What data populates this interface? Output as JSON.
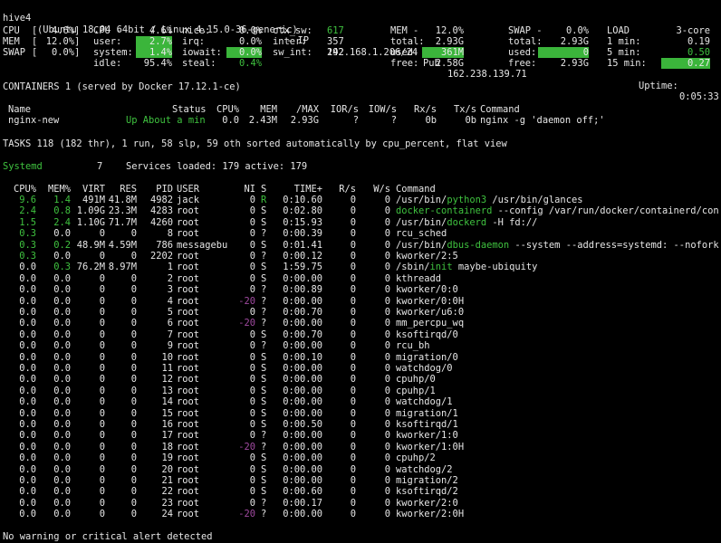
{
  "header": {
    "host": "hive4",
    "os": "(Ubuntu 18.04 64bit / Linux 4.15.0-36-generic)",
    "ip_label": "- IP",
    "ip": "192.168.1.206/24",
    "pub_label": "Pub",
    "pub": "162.238.139.71",
    "uptime_label": "Uptime:",
    "uptime": "0:05:33"
  },
  "quicklook": {
    "cpu": {
      "label": "CPU",
      "pct": "4.6%"
    },
    "mem": {
      "label": "MEM",
      "pct": "12.0%"
    },
    "swap": {
      "label": "SWAP",
      "pct": "0.0%"
    }
  },
  "cpu": {
    "title": "CPU -",
    "total": "4.6%",
    "user_label": "user:",
    "user": "2.7%",
    "system_label": "system:",
    "system": "1.4%",
    "idle_label": "idle:",
    "idle": "95.4%",
    "nice_label": "nice:",
    "nice": "0.0%",
    "irq_label": "irq:",
    "irq": "0.0%",
    "iowait_label": "iowait:",
    "iowait": "0.0%",
    "steal_label": "steal:",
    "steal": "0.4%",
    "ctxsw_label": "ctx_sw:",
    "ctxsw": "617",
    "inter_label": "inter:",
    "inter": "357",
    "swint_label": "sw_int:",
    "swint": "242"
  },
  "mem": {
    "title": "MEM -",
    "pct": "12.0%",
    "total_label": "total:",
    "total": "2.93G",
    "used_label": "used:",
    "used": "361M",
    "free_label": "free:",
    "free": "2.58G"
  },
  "swap": {
    "title": "SWAP -",
    "pct": "0.0%",
    "total_label": "total:",
    "total": "2.93G",
    "used_label": "used:",
    "used": "0",
    "free_label": "free:",
    "free": "2.93G"
  },
  "load": {
    "title": "LOAD",
    "cores": "3-core",
    "m1_label": "1 min:",
    "m1": "0.19",
    "m5_label": "5 min:",
    "m5": "0.50",
    "m15_label": "15 min:",
    "m15": "0.27"
  },
  "containers": {
    "title": "CONTAINERS 1 (served by Docker 17.12.1-ce)",
    "headers": {
      "name": "Name",
      "status": "Status",
      "cpu": "CPU%",
      "mem": "MEM",
      "max": "/MAX",
      "ior": "IOR/s",
      "iow": "IOW/s",
      "rx": "Rx/s",
      "tx": "Tx/s",
      "cmd": "Command"
    },
    "row": {
      "name": "nginx-new",
      "status": "Up About a min",
      "cpu": "0.0",
      "mem": "2.43M",
      "max": "2.93G",
      "ior": "?",
      "iow": "?",
      "rx": "0b",
      "tx": "0b",
      "cmd": "nginx -g 'daemon off;'"
    }
  },
  "tasks": {
    "summary": "TASKS 118 (182 thr), 1 run, 58 slp, 59 oth sorted automatically by cpu_percent, flat view"
  },
  "systemd": {
    "label": "Systemd",
    "count": "7",
    "services": "Services loaded: 179 active: 179"
  },
  "proc_headers": {
    "cpu": "CPU%",
    "mem": "MEM%",
    "virt": "VIRT",
    "res": "RES",
    "pid": "PID",
    "user": "USER",
    "ni": "NI",
    "s": "S",
    "time": "TIME+",
    "r": "R/s",
    "w": "W/s",
    "cmd": "Command"
  },
  "processes": [
    {
      "cpu": "9.6",
      "mem": "1.4",
      "virt": "491M",
      "res": "41.8M",
      "pid": "4982",
      "user": "jack",
      "ni": "0",
      "s": "R",
      "time": "0:10.60",
      "r": "0",
      "w": "0",
      "cmd_pre": "/usr/bin/",
      "cmd_hi": "python3",
      "cmd_post": " /usr/bin/glances"
    },
    {
      "cpu": "2.4",
      "mem": "0.8",
      "virt": "1.09G",
      "res": "23.3M",
      "pid": "4283",
      "user": "root",
      "ni": "0",
      "s": "S",
      "time": "0:02.80",
      "r": "0",
      "w": "0",
      "cmd_pre": "",
      "cmd_hi": "docker-containerd",
      "cmd_post": " --config /var/run/docker/containerd/con"
    },
    {
      "cpu": "1.5",
      "mem": "2.4",
      "virt": "1.10G",
      "res": "71.7M",
      "pid": "4260",
      "user": "root",
      "ni": "0",
      "s": "S",
      "time": "0:15.93",
      "r": "0",
      "w": "0",
      "cmd_pre": "/usr/bin/",
      "cmd_hi": "dockerd",
      "cmd_post": " -H fd://"
    },
    {
      "cpu": "0.3",
      "mem": "0.0",
      "virt": "0",
      "res": "0",
      "pid": "8",
      "user": "root",
      "ni": "0",
      "s": "?",
      "time": "0:00.39",
      "r": "0",
      "w": "0",
      "cmd_pre": "rcu_sched",
      "cmd_hi": "",
      "cmd_post": ""
    },
    {
      "cpu": "0.3",
      "mem": "0.2",
      "virt": "48.9M",
      "res": "4.59M",
      "pid": "786",
      "user": "messagebu",
      "ni": "0",
      "s": "S",
      "time": "0:01.41",
      "r": "0",
      "w": "0",
      "cmd_pre": "/usr/bin/",
      "cmd_hi": "dbus-daemon",
      "cmd_post": " --system --address=systemd: --nofork"
    },
    {
      "cpu": "0.3",
      "mem": "0.0",
      "virt": "0",
      "res": "0",
      "pid": "2202",
      "user": "root",
      "ni": "0",
      "s": "?",
      "time": "0:00.12",
      "r": "0",
      "w": "0",
      "cmd_pre": "kworker/2:5",
      "cmd_hi": "",
      "cmd_post": ""
    },
    {
      "cpu": "0.0",
      "mem": "0.3",
      "virt": "76.2M",
      "res": "8.97M",
      "pid": "1",
      "user": "root",
      "ni": "0",
      "s": "S",
      "time": "1:59.75",
      "r": "0",
      "w": "0",
      "cmd_pre": "/sbin/",
      "cmd_hi": "init",
      "cmd_post": " maybe-ubiquity"
    },
    {
      "cpu": "0.0",
      "mem": "0.0",
      "virt": "0",
      "res": "0",
      "pid": "2",
      "user": "root",
      "ni": "0",
      "s": "S",
      "time": "0:00.00",
      "r": "0",
      "w": "0",
      "cmd_pre": "kthreadd",
      "cmd_hi": "",
      "cmd_post": ""
    },
    {
      "cpu": "0.0",
      "mem": "0.0",
      "virt": "0",
      "res": "0",
      "pid": "3",
      "user": "root",
      "ni": "0",
      "s": "?",
      "time": "0:00.89",
      "r": "0",
      "w": "0",
      "cmd_pre": "kworker/0:0",
      "cmd_hi": "",
      "cmd_post": ""
    },
    {
      "cpu": "0.0",
      "mem": "0.0",
      "virt": "0",
      "res": "0",
      "pid": "4",
      "user": "root",
      "ni": "-20",
      "s": "?",
      "time": "0:00.00",
      "r": "0",
      "w": "0",
      "cmd_pre": "kworker/0:0H",
      "cmd_hi": "",
      "cmd_post": ""
    },
    {
      "cpu": "0.0",
      "mem": "0.0",
      "virt": "0",
      "res": "0",
      "pid": "5",
      "user": "root",
      "ni": "0",
      "s": "?",
      "time": "0:00.70",
      "r": "0",
      "w": "0",
      "cmd_pre": "kworker/u6:0",
      "cmd_hi": "",
      "cmd_post": ""
    },
    {
      "cpu": "0.0",
      "mem": "0.0",
      "virt": "0",
      "res": "0",
      "pid": "6",
      "user": "root",
      "ni": "-20",
      "s": "?",
      "time": "0:00.00",
      "r": "0",
      "w": "0",
      "cmd_pre": "mm_percpu_wq",
      "cmd_hi": "",
      "cmd_post": ""
    },
    {
      "cpu": "0.0",
      "mem": "0.0",
      "virt": "0",
      "res": "0",
      "pid": "7",
      "user": "root",
      "ni": "0",
      "s": "S",
      "time": "0:00.70",
      "r": "0",
      "w": "0",
      "cmd_pre": "ksoftirqd/0",
      "cmd_hi": "",
      "cmd_post": ""
    },
    {
      "cpu": "0.0",
      "mem": "0.0",
      "virt": "0",
      "res": "0",
      "pid": "9",
      "user": "root",
      "ni": "0",
      "s": "?",
      "time": "0:00.00",
      "r": "0",
      "w": "0",
      "cmd_pre": "rcu_bh",
      "cmd_hi": "",
      "cmd_post": ""
    },
    {
      "cpu": "0.0",
      "mem": "0.0",
      "virt": "0",
      "res": "0",
      "pid": "10",
      "user": "root",
      "ni": "0",
      "s": "S",
      "time": "0:00.10",
      "r": "0",
      "w": "0",
      "cmd_pre": "migration/0",
      "cmd_hi": "",
      "cmd_post": ""
    },
    {
      "cpu": "0.0",
      "mem": "0.0",
      "virt": "0",
      "res": "0",
      "pid": "11",
      "user": "root",
      "ni": "0",
      "s": "S",
      "time": "0:00.00",
      "r": "0",
      "w": "0",
      "cmd_pre": "watchdog/0",
      "cmd_hi": "",
      "cmd_post": ""
    },
    {
      "cpu": "0.0",
      "mem": "0.0",
      "virt": "0",
      "res": "0",
      "pid": "12",
      "user": "root",
      "ni": "0",
      "s": "S",
      "time": "0:00.00",
      "r": "0",
      "w": "0",
      "cmd_pre": "cpuhp/0",
      "cmd_hi": "",
      "cmd_post": ""
    },
    {
      "cpu": "0.0",
      "mem": "0.0",
      "virt": "0",
      "res": "0",
      "pid": "13",
      "user": "root",
      "ni": "0",
      "s": "S",
      "time": "0:00.00",
      "r": "0",
      "w": "0",
      "cmd_pre": "cpuhp/1",
      "cmd_hi": "",
      "cmd_post": ""
    },
    {
      "cpu": "0.0",
      "mem": "0.0",
      "virt": "0",
      "res": "0",
      "pid": "14",
      "user": "root",
      "ni": "0",
      "s": "S",
      "time": "0:00.00",
      "r": "0",
      "w": "0",
      "cmd_pre": "watchdog/1",
      "cmd_hi": "",
      "cmd_post": ""
    },
    {
      "cpu": "0.0",
      "mem": "0.0",
      "virt": "0",
      "res": "0",
      "pid": "15",
      "user": "root",
      "ni": "0",
      "s": "S",
      "time": "0:00.00",
      "r": "0",
      "w": "0",
      "cmd_pre": "migration/1",
      "cmd_hi": "",
      "cmd_post": ""
    },
    {
      "cpu": "0.0",
      "mem": "0.0",
      "virt": "0",
      "res": "0",
      "pid": "16",
      "user": "root",
      "ni": "0",
      "s": "S",
      "time": "0:00.50",
      "r": "0",
      "w": "0",
      "cmd_pre": "ksoftirqd/1",
      "cmd_hi": "",
      "cmd_post": ""
    },
    {
      "cpu": "0.0",
      "mem": "0.0",
      "virt": "0",
      "res": "0",
      "pid": "17",
      "user": "root",
      "ni": "0",
      "s": "?",
      "time": "0:00.00",
      "r": "0",
      "w": "0",
      "cmd_pre": "kworker/1:0",
      "cmd_hi": "",
      "cmd_post": ""
    },
    {
      "cpu": "0.0",
      "mem": "0.0",
      "virt": "0",
      "res": "0",
      "pid": "18",
      "user": "root",
      "ni": "-20",
      "s": "?",
      "time": "0:00.00",
      "r": "0",
      "w": "0",
      "cmd_pre": "kworker/1:0H",
      "cmd_hi": "",
      "cmd_post": ""
    },
    {
      "cpu": "0.0",
      "mem": "0.0",
      "virt": "0",
      "res": "0",
      "pid": "19",
      "user": "root",
      "ni": "0",
      "s": "S",
      "time": "0:00.00",
      "r": "0",
      "w": "0",
      "cmd_pre": "cpuhp/2",
      "cmd_hi": "",
      "cmd_post": ""
    },
    {
      "cpu": "0.0",
      "mem": "0.0",
      "virt": "0",
      "res": "0",
      "pid": "20",
      "user": "root",
      "ni": "0",
      "s": "S",
      "time": "0:00.00",
      "r": "0",
      "w": "0",
      "cmd_pre": "watchdog/2",
      "cmd_hi": "",
      "cmd_post": ""
    },
    {
      "cpu": "0.0",
      "mem": "0.0",
      "virt": "0",
      "res": "0",
      "pid": "21",
      "user": "root",
      "ni": "0",
      "s": "S",
      "time": "0:00.00",
      "r": "0",
      "w": "0",
      "cmd_pre": "migration/2",
      "cmd_hi": "",
      "cmd_post": ""
    },
    {
      "cpu": "0.0",
      "mem": "0.0",
      "virt": "0",
      "res": "0",
      "pid": "22",
      "user": "root",
      "ni": "0",
      "s": "S",
      "time": "0:00.60",
      "r": "0",
      "w": "0",
      "cmd_pre": "ksoftirqd/2",
      "cmd_hi": "",
      "cmd_post": ""
    },
    {
      "cpu": "0.0",
      "mem": "0.0",
      "virt": "0",
      "res": "0",
      "pid": "23",
      "user": "root",
      "ni": "0",
      "s": "?",
      "time": "0:00.17",
      "r": "0",
      "w": "0",
      "cmd_pre": "kworker/2:0",
      "cmd_hi": "",
      "cmd_post": ""
    },
    {
      "cpu": "0.0",
      "mem": "0.0",
      "virt": "0",
      "res": "0",
      "pid": "24",
      "user": "root",
      "ni": "-20",
      "s": "?",
      "time": "0:00.00",
      "r": "0",
      "w": "0",
      "cmd_pre": "kworker/2:0H",
      "cmd_hi": "",
      "cmd_post": ""
    }
  ],
  "footer": {
    "alert": "No warning or critical alert detected"
  },
  "colors": {
    "green": "#3fc23f",
    "highlight": "#3bb53b",
    "magenta": "#a04aa0",
    "background": "#000000",
    "text": "#e6e6e6"
  }
}
